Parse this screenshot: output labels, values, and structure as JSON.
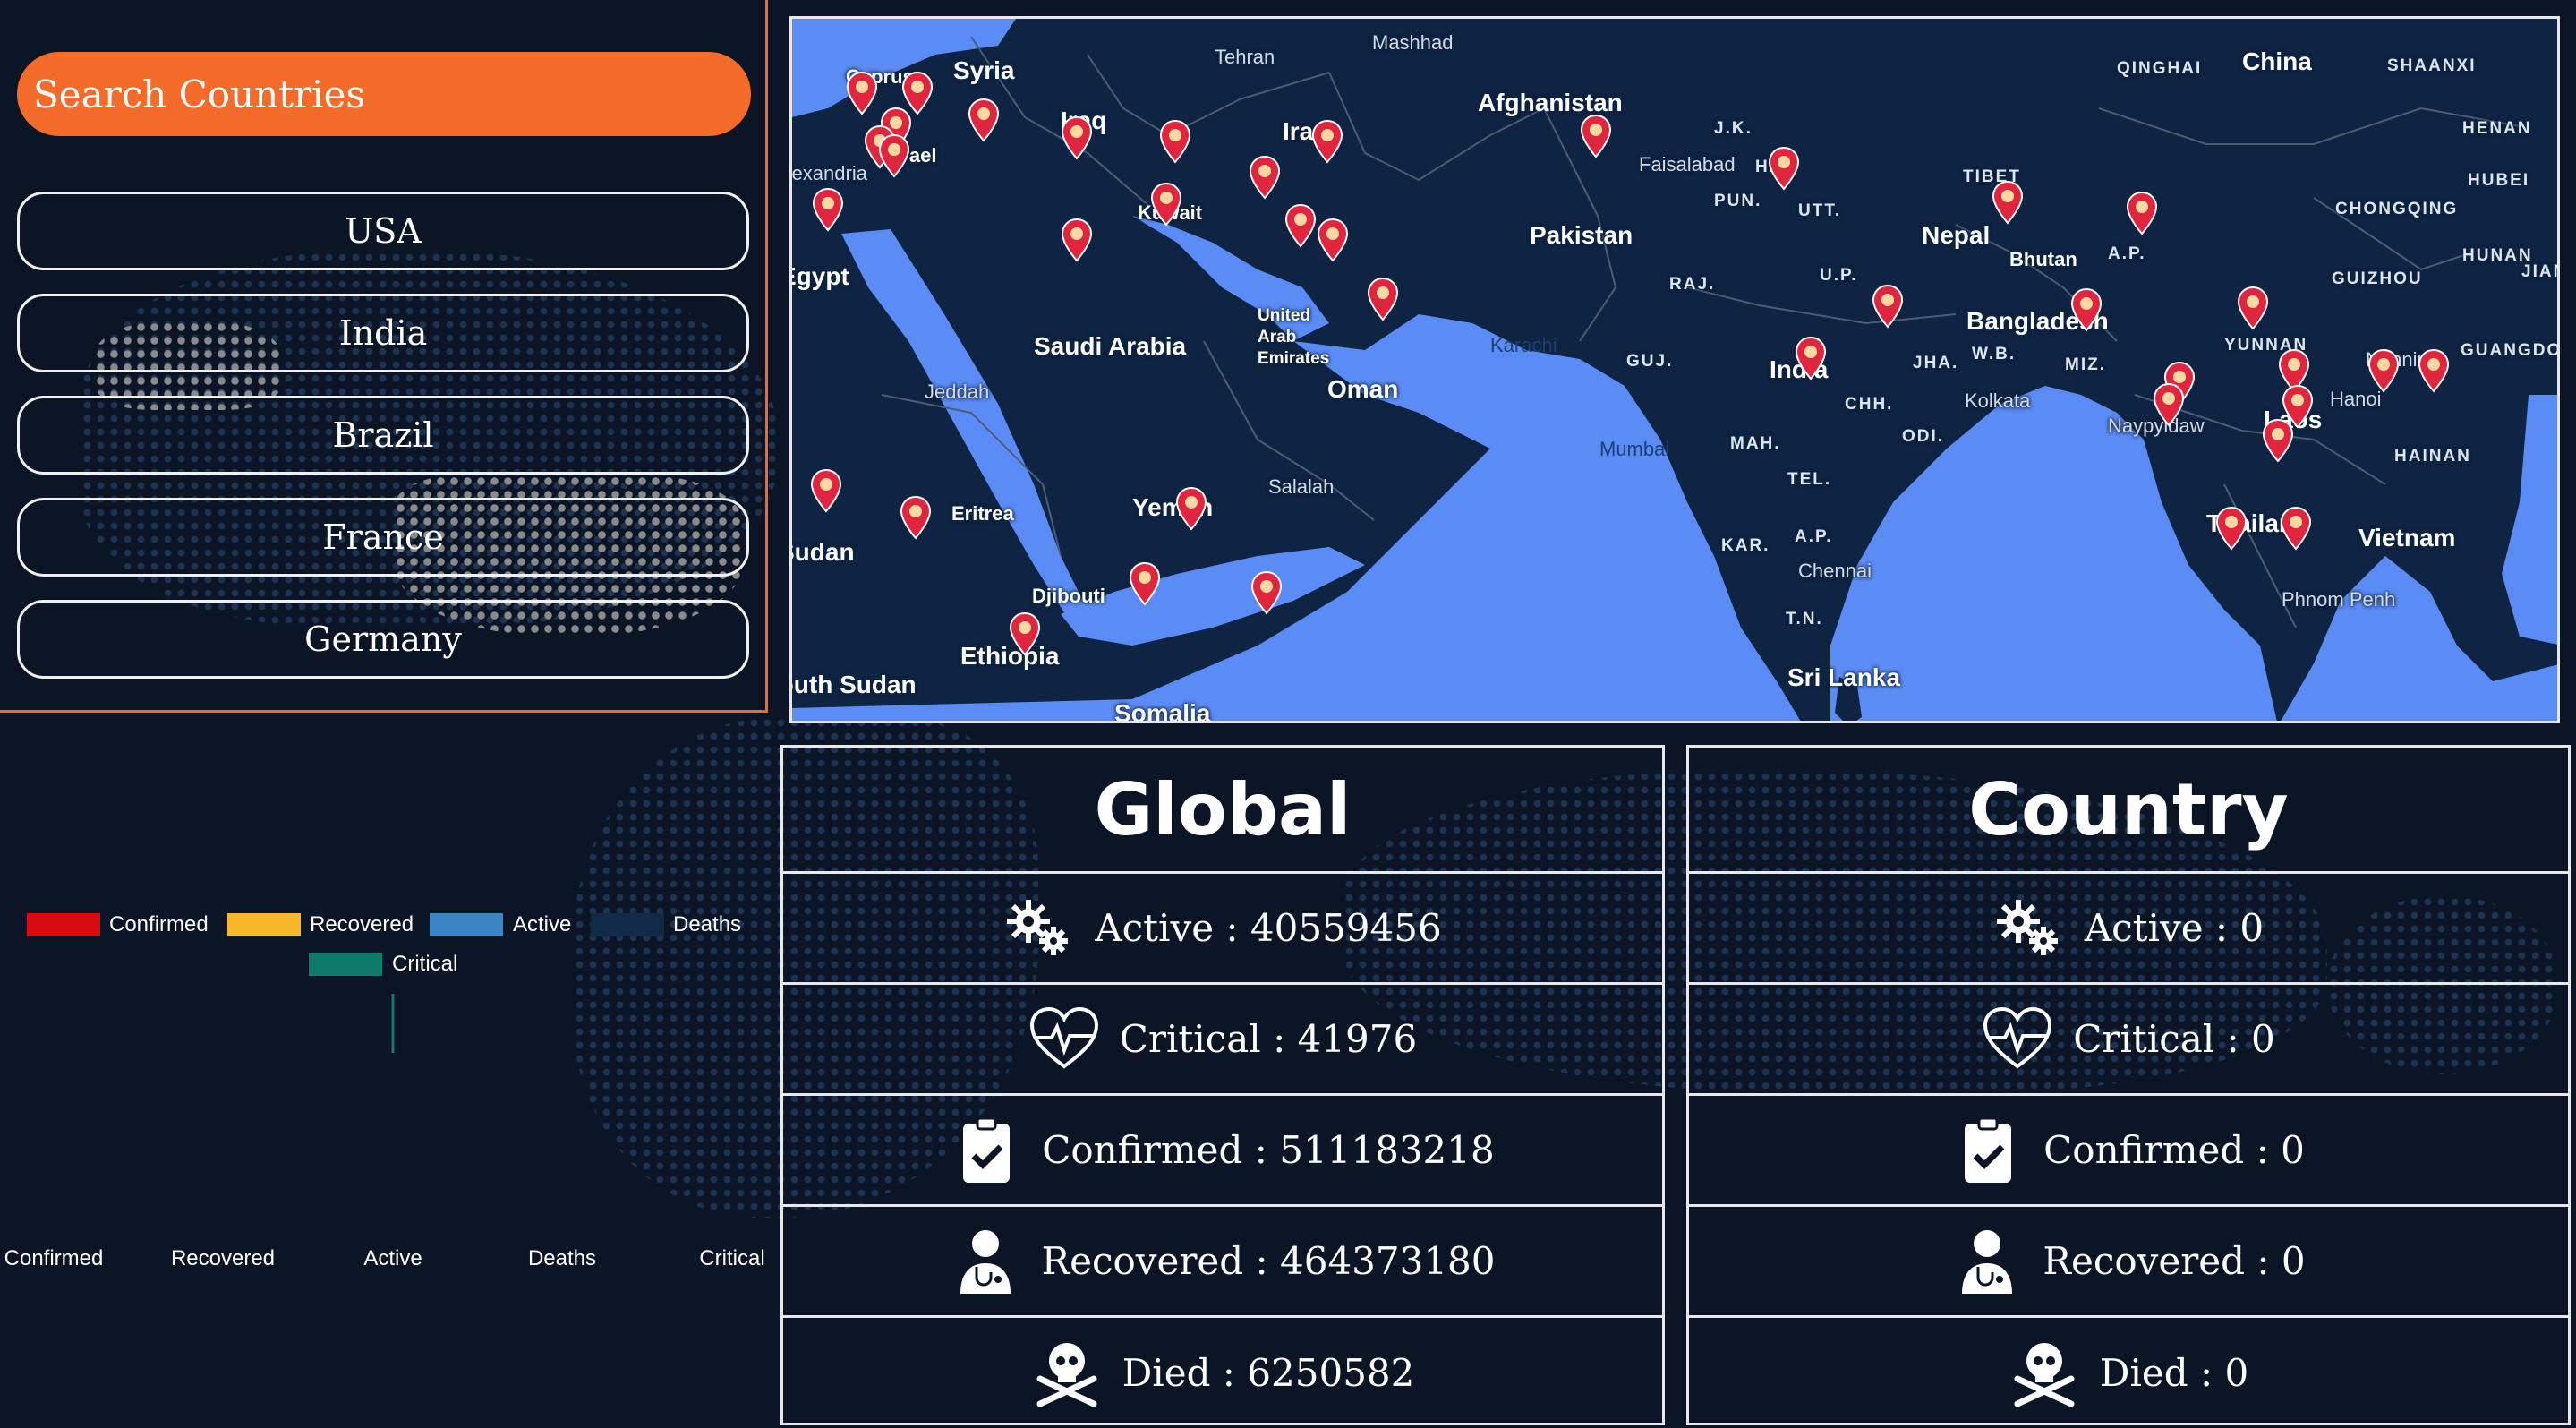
{
  "search": {
    "label": "Search Countries"
  },
  "countries": [
    "USA",
    "India",
    "Brazil",
    "France",
    "Germany"
  ],
  "chart_data": {
    "type": "bar",
    "categories": [
      "Confirmed",
      "Recovered",
      "Active",
      "Deaths",
      "Critical"
    ],
    "series": [
      {
        "name": "Confirmed",
        "color": "#d90b12",
        "values": [
          0,
          0,
          0,
          0,
          0
        ]
      },
      {
        "name": "Recovered",
        "color": "#f6b82a",
        "values": [
          0,
          0,
          0,
          0,
          0
        ]
      },
      {
        "name": "Active",
        "color": "#3d86c6",
        "values": [
          0,
          0,
          0,
          0,
          0
        ]
      },
      {
        "name": "Deaths",
        "color": "#102a47",
        "values": [
          0,
          0,
          0,
          0,
          0
        ]
      },
      {
        "name": "Critical",
        "color": "#0f7a6a",
        "values": [
          0,
          0,
          0,
          0,
          0
        ]
      }
    ],
    "legend": "top-center",
    "grid": false
  },
  "map": {
    "labels": [
      "Cyprus",
      "Syria",
      "Tehran",
      "Mashhad",
      "Iraq",
      "Israel",
      "Iran",
      "Afghanistan",
      "J.K.",
      "Faisalabad",
      "H.P.",
      "PUN.",
      "UTT.",
      "TIBET",
      "QINGHAI",
      "China",
      "SHAANXI",
      "HENAN",
      "HUBEI",
      "CHONGQING",
      "HUNAN",
      "GUIZHOU",
      "JIAN",
      "Kuwait",
      "Pakistan",
      "Nepal",
      "A.P.",
      "RAJ.",
      "U.P.",
      "Bhutan",
      "Egypt",
      "Saudi Arabia",
      "United Arab Emirates",
      "Karachi",
      "GUJ.",
      "India",
      "JHA.",
      "W.B.",
      "Bangladesh",
      "MIZ.",
      "YUNNAN",
      "Nanning",
      "GUANGDO",
      "Jeddah",
      "Oman",
      "Kolkata",
      "CHH.",
      "Hanoi",
      "Mumbai",
      "Naypyidaw",
      "Laos",
      "ODI.",
      "MAH.",
      "TEL.",
      "HAINAN",
      "Salalah",
      "Yemen",
      "Eritrea",
      "Thailand",
      "Vietnam",
      "KAR.",
      "A.P.",
      "Chennai",
      "Sudan",
      "Djibouti",
      "Phnom Penh",
      "T.N.",
      "Ethiopia",
      "Sri Lanka",
      "South Sudan",
      "Somalia",
      "Alexandria"
    ]
  },
  "global": {
    "title": "Global",
    "active": "Active : 40559456",
    "critical": "Critical : 41976",
    "confirmed": "Confirmed : 511183218",
    "recovered": "Recovered : 464373180",
    "died": "Died : 6250582"
  },
  "country": {
    "title": "Country",
    "active": "Active : 0",
    "critical": "Critical : 0",
    "confirmed": "Confirmed : 0",
    "recovered": "Recovered : 0",
    "died": "Died : 0"
  },
  "colors": {
    "accent": "#f46b2a",
    "background": "#0b1526",
    "sea": "#5b8cf5",
    "land": "#0e2442",
    "pin": "#e0263f"
  }
}
